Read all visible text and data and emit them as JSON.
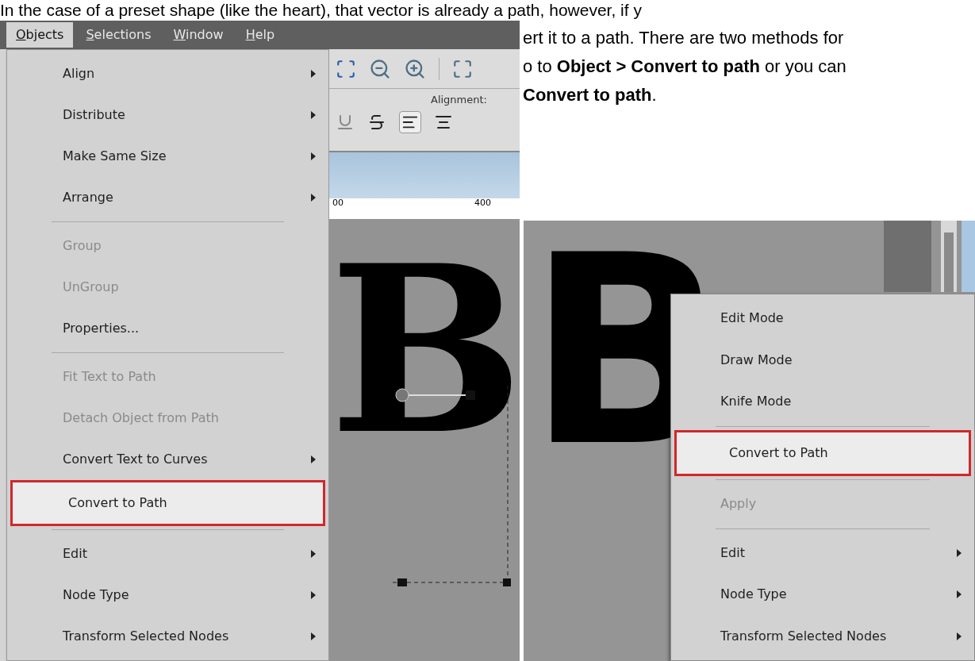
{
  "article": {
    "lines": [
      "In the case of a preset shape (like the heart), that vector is already a path, however, if y",
      "ert it to a path. There are two methods for",
      "o to **Object > Convert to path** or you can",
      "**Convert to path**."
    ]
  },
  "left_screenshot": {
    "menubar": [
      {
        "label": "Objects",
        "selected": true
      },
      {
        "label": "Selections",
        "selected": false
      },
      {
        "label": "Window",
        "selected": false
      },
      {
        "label": "Help",
        "selected": false
      }
    ],
    "menu": [
      {
        "kind": "item",
        "label": "Align",
        "submenu": true,
        "disabled": false,
        "selected": false
      },
      {
        "kind": "item",
        "label": "Distribute",
        "submenu": true,
        "disabled": false,
        "selected": false
      },
      {
        "kind": "item",
        "label": "Make Same Size",
        "submenu": true,
        "disabled": false,
        "selected": false
      },
      {
        "kind": "item",
        "label": "Arrange",
        "submenu": true,
        "disabled": false,
        "selected": false
      },
      {
        "kind": "separator"
      },
      {
        "kind": "item",
        "label": "Group",
        "submenu": false,
        "disabled": true,
        "selected": false
      },
      {
        "kind": "item",
        "label": "UnGroup",
        "submenu": false,
        "disabled": true,
        "selected": false
      },
      {
        "kind": "item",
        "label": "Properties...",
        "submenu": false,
        "disabled": false,
        "selected": false
      },
      {
        "kind": "separator"
      },
      {
        "kind": "item",
        "label": "Fit Text to Path",
        "submenu": false,
        "disabled": true,
        "selected": false
      },
      {
        "kind": "item",
        "label": "Detach Object from Path",
        "submenu": false,
        "disabled": true,
        "selected": false
      },
      {
        "kind": "item",
        "label": "Convert Text to Curves",
        "submenu": true,
        "disabled": false,
        "selected": false
      },
      {
        "kind": "item",
        "label": "Convert to Path",
        "submenu": false,
        "disabled": false,
        "selected": true
      },
      {
        "kind": "separator"
      },
      {
        "kind": "item",
        "label": "Edit",
        "submenu": true,
        "disabled": false,
        "selected": false
      },
      {
        "kind": "item",
        "label": "Node Type",
        "submenu": true,
        "disabled": false,
        "selected": false
      },
      {
        "kind": "item",
        "label": "Transform Selected Nodes",
        "submenu": true,
        "disabled": false,
        "selected": false
      }
    ],
    "alignment_label": "Alignment:",
    "ruler_labels": [
      "00",
      "400"
    ],
    "canvas_text": "B"
  },
  "right_screenshot": {
    "canvas_text": "B",
    "menu": [
      {
        "kind": "item",
        "label": "Edit Mode",
        "submenu": false,
        "disabled": false,
        "selected": false
      },
      {
        "kind": "item",
        "label": "Draw Mode",
        "submenu": false,
        "disabled": false,
        "selected": false
      },
      {
        "kind": "item",
        "label": "Knife Mode",
        "submenu": false,
        "disabled": false,
        "selected": false
      },
      {
        "kind": "separator"
      },
      {
        "kind": "item",
        "label": "Convert to Path",
        "submenu": false,
        "disabled": false,
        "selected": true
      },
      {
        "kind": "separator"
      },
      {
        "kind": "item",
        "label": "Apply",
        "submenu": false,
        "disabled": true,
        "selected": false
      },
      {
        "kind": "separator"
      },
      {
        "kind": "item",
        "label": "Edit",
        "submenu": true,
        "disabled": false,
        "selected": false
      },
      {
        "kind": "item",
        "label": "Node Type",
        "submenu": true,
        "disabled": false,
        "selected": false
      },
      {
        "kind": "item",
        "label": "Transform Selected Nodes",
        "submenu": true,
        "disabled": false,
        "selected": false
      }
    ]
  }
}
